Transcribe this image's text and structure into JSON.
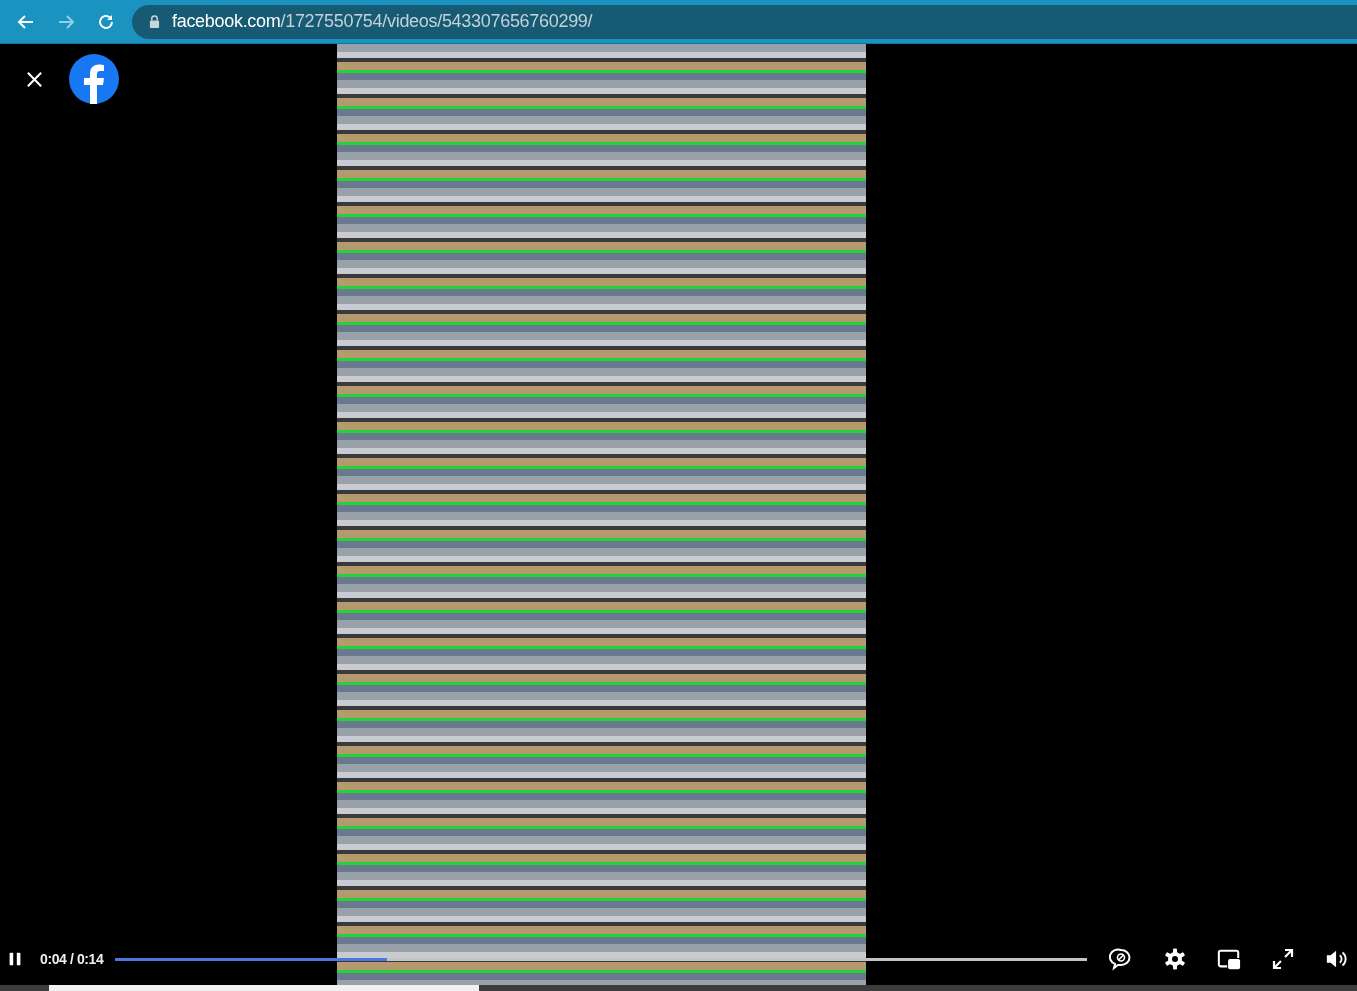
{
  "browser": {
    "url_host": "facebook.com",
    "url_path": "/1727550754/videos/543307656760299/"
  },
  "player": {
    "playing": true,
    "time": "0:04 / 0:14",
    "progress": {
      "level": 0.28
    }
  }
}
